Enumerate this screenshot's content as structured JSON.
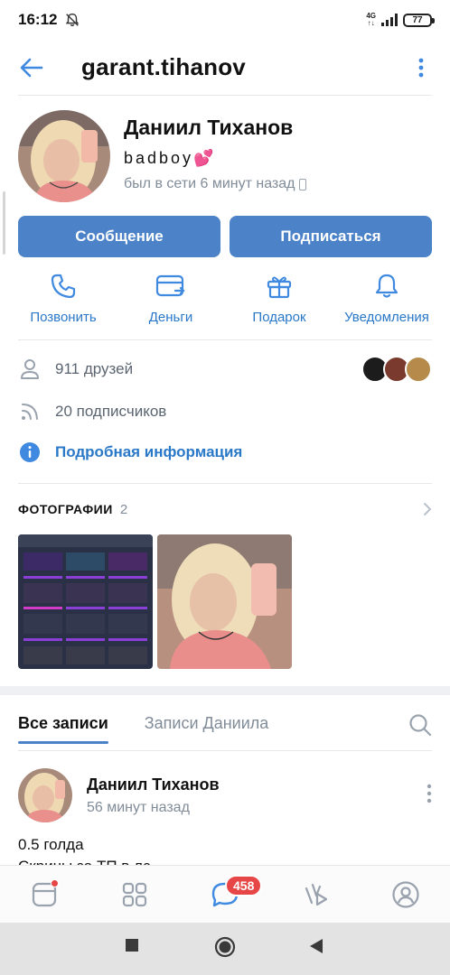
{
  "status_bar": {
    "time": "16:12",
    "network": "4G",
    "battery": "77"
  },
  "header": {
    "title": "garant.tihanov"
  },
  "profile": {
    "name": "Даниил Тиханов",
    "status_text": "badboy",
    "status_emoji": "💕",
    "last_seen": "был в сети 6 минут назад"
  },
  "actions": {
    "message": "Сообщение",
    "subscribe": "Подписаться"
  },
  "quick_actions": [
    {
      "label": "Позвонить",
      "icon": "phone-icon"
    },
    {
      "label": "Деньги",
      "icon": "money-card-icon"
    },
    {
      "label": "Подарок",
      "icon": "gift-icon"
    },
    {
      "label": "Уведомления",
      "icon": "bell-icon"
    }
  ],
  "info": {
    "friends": "911 друзей",
    "followers": "20 подписчиков",
    "details": "Подробная информация"
  },
  "photos": {
    "title": "ФОТОГРАФИИ",
    "count": "2"
  },
  "wall": {
    "tab_all": "Все записи",
    "tab_own": "Записи Даниила"
  },
  "post": {
    "author": "Даниил Тиханов",
    "time": "56 минут назад",
    "text": "0.5 голда",
    "text_partial": "Скрины за ТП в лс"
  },
  "bottom_nav": {
    "messages_badge": "458"
  },
  "colors": {
    "accent": "#4b82c8",
    "link": "#2a78c8",
    "badge": "#e64646"
  }
}
